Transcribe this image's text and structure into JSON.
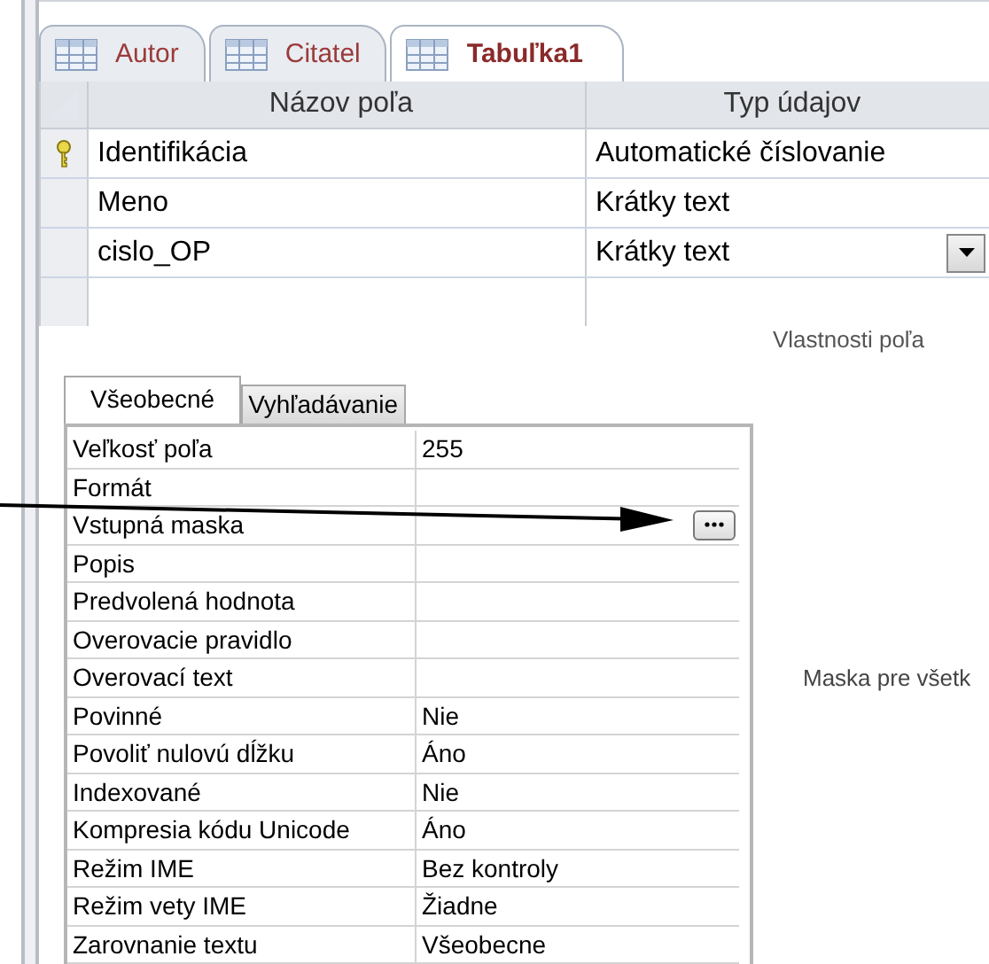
{
  "tabs": [
    {
      "label": "Autor",
      "selected": false
    },
    {
      "label": "Citatel",
      "selected": false
    },
    {
      "label": "Tabuľka1",
      "selected": true
    }
  ],
  "grid": {
    "columns": [
      "Názov poľa",
      "Typ údajov"
    ],
    "rows": [
      {
        "name": "Identifikácia",
        "type": "Automatické číslovanie",
        "primary_key": true,
        "selected": false
      },
      {
        "name": "Meno",
        "type": "Krátky text",
        "primary_key": false,
        "selected": false
      },
      {
        "name": "cislo_OP",
        "type": "Krátky text",
        "primary_key": false,
        "selected": true
      }
    ]
  },
  "properties_title": "Vlastnosti poľa",
  "property_tabs": [
    {
      "label": "Všeobecné",
      "selected": true
    },
    {
      "label": "Vyhľadávanie",
      "selected": false
    }
  ],
  "properties": [
    {
      "label": "Veľkosť poľa",
      "value": "255",
      "builder": false
    },
    {
      "label": "Formát",
      "builder": false
    },
    {
      "label": "Vstupná maska",
      "builder": true
    },
    {
      "label": "Popis",
      "builder": false
    },
    {
      "label": "Predvolená hodnota",
      "builder": false
    },
    {
      "label": "Overovacie pravidlo",
      "builder": false
    },
    {
      "label": "Overovací text",
      "builder": false
    },
    {
      "label": "Povinné",
      "value": "Nie",
      "builder": false
    },
    {
      "label": "Povoliť nulovú dĺžku",
      "value": "Áno",
      "builder": false
    },
    {
      "label": "Indexované",
      "value": "Nie",
      "builder": false
    },
    {
      "label": "Kompresia kódu Unicode",
      "value": "Áno",
      "builder": false
    },
    {
      "label": "Režim IME",
      "value": "Bez kontroly",
      "builder": false
    },
    {
      "label": "Režim vety IME",
      "value": "Žiadne",
      "builder": false
    },
    {
      "label": "Zarovnanie textu",
      "value": "Všeobecne",
      "builder": false
    }
  ],
  "help_text": "Maska pre všetk"
}
